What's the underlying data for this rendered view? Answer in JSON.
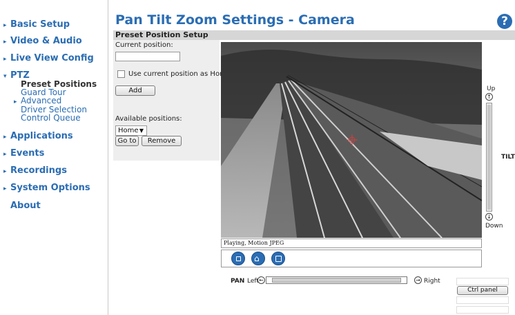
{
  "sidebar": {
    "basic_setup": "Basic Setup",
    "video_audio": "Video & Audio",
    "live_view_config": "Live View Config",
    "ptz": "PTZ",
    "ptz_items": [
      "Preset Positions",
      "Guard Tour",
      "Advanced",
      "Driver Selection",
      "Control Queue"
    ],
    "applications": "Applications",
    "events": "Events",
    "recordings": "Recordings",
    "system_options": "System Options",
    "about": "About"
  },
  "header": {
    "title": "Pan Tilt Zoom Settings - Camera",
    "help_icon": "?"
  },
  "section": {
    "title": "Preset Position Setup"
  },
  "preset": {
    "current_label": "Current position:",
    "current_value": "",
    "use_home_label": "Use current position as Home",
    "add_label": "Add",
    "available_label": "Available positions:",
    "selected_position": "Home",
    "goto_label": "Go to",
    "remove_label": "Remove"
  },
  "video": {
    "status": "Playing, Motion JPEG"
  },
  "tilt": {
    "up": "Up",
    "down": "Down",
    "label": "TILT"
  },
  "pan": {
    "label": "PAN",
    "left": "Left",
    "right": "Right"
  },
  "ctrl_panel": "Ctrl panel",
  "colors": {
    "accent": "#2b6db3",
    "section_bg": "#d6d6d6",
    "panel_bg": "#eeeeee"
  }
}
